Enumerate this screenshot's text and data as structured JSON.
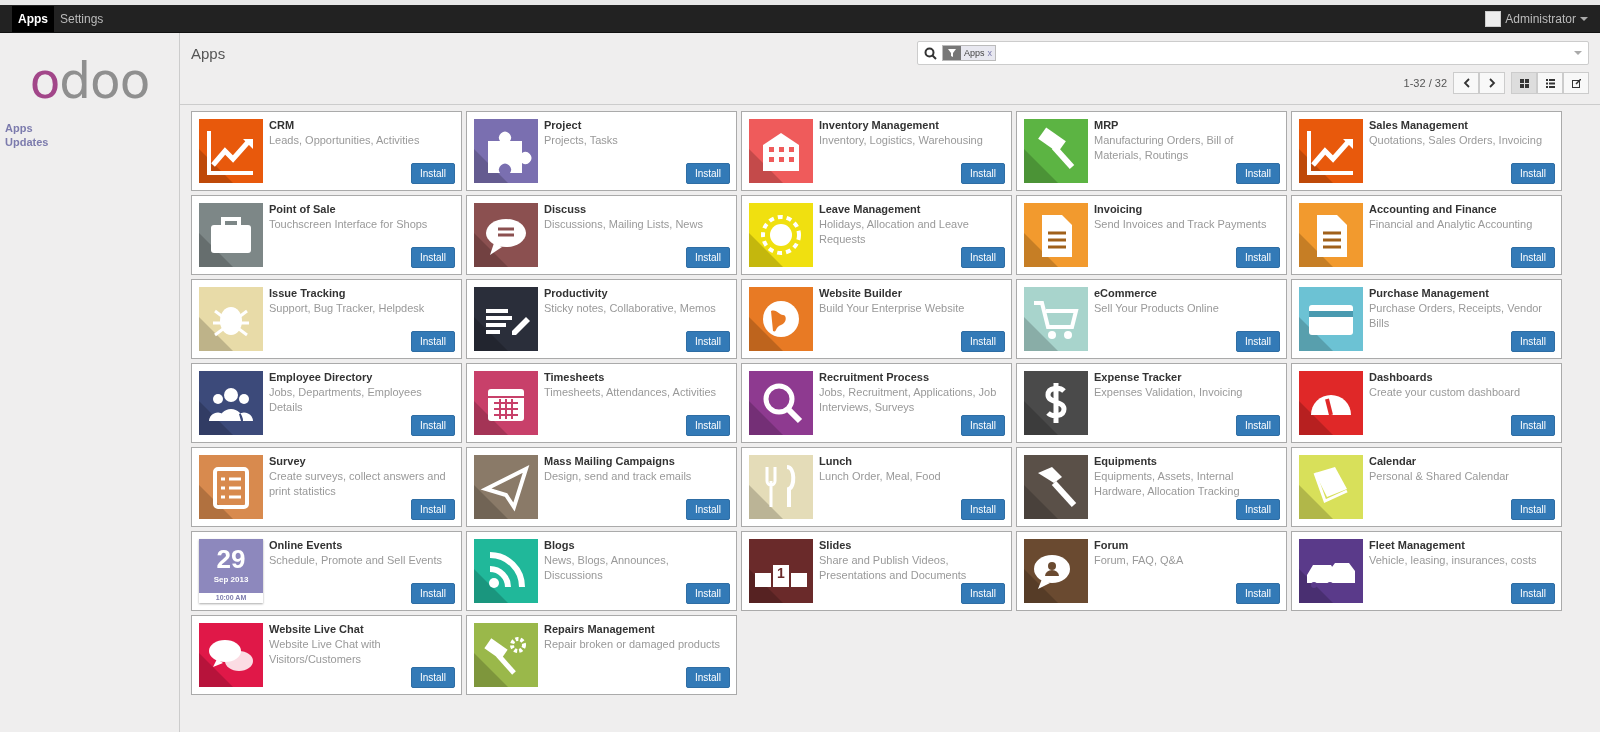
{
  "top_menu": [
    {
      "label": "Apps",
      "selected": true
    },
    {
      "label": "Settings",
      "selected": false
    }
  ],
  "user": {
    "name": "Administrator"
  },
  "logo": "odoo",
  "sidebar": {
    "items": [
      {
        "label": "Apps"
      },
      {
        "label": "Updates"
      }
    ]
  },
  "header": {
    "title": "Apps",
    "search": {
      "facet": "Apps",
      "remove": "x"
    },
    "pager": "1-32 / 32",
    "views": [
      {
        "kind": "kanban",
        "selected": true
      },
      {
        "kind": "list",
        "selected": false
      },
      {
        "kind": "form",
        "selected": false
      }
    ]
  },
  "apps": [
    {
      "name": "CRM",
      "summary": "Leads, Opportunities, Activities",
      "color": "#e8590c",
      "kind": "chart",
      "button": "Install"
    },
    {
      "name": "Project",
      "summary": "Projects, Tasks",
      "color": "#7a6fb0",
      "kind": "puzzle",
      "button": "Install"
    },
    {
      "name": "Inventory Management",
      "summary": "Inventory, Logistics, Warehousing",
      "color": "#ef5b5b",
      "kind": "building",
      "button": "Install"
    },
    {
      "name": "MRP",
      "summary": "Manufacturing Orders, Bill of Materials, Routings",
      "color": "#5cb443",
      "kind": "gavel",
      "button": "Install"
    },
    {
      "name": "Sales Management",
      "summary": "Quotations, Sales Orders, Invoicing",
      "color": "#e8590c",
      "kind": "chart",
      "button": "Install"
    },
    {
      "name": "Point of Sale",
      "summary": "Touchscreen Interface for Shops",
      "color": "#7d8787",
      "kind": "bag",
      "button": "Install"
    },
    {
      "name": "Discuss",
      "summary": "Discussions, Mailing Lists, News",
      "color": "#8b5050",
      "kind": "speech",
      "button": "Install"
    },
    {
      "name": "Leave Management",
      "summary": "Holidays, Allocation and Leave Requests",
      "color": "#f0e010",
      "kind": "sun",
      "button": "Install"
    },
    {
      "name": "Invoicing",
      "summary": "Send Invoices and Track Payments",
      "color": "#f29a2e",
      "kind": "document",
      "button": "Install"
    },
    {
      "name": "Accounting and Finance",
      "summary": "Financial and Analytic Accounting",
      "color": "#f29a2e",
      "kind": "document",
      "button": "Install"
    },
    {
      "name": "Issue Tracking",
      "summary": "Support, Bug Tracker, Helpdesk",
      "color": "#e8dba8",
      "kind": "bug",
      "button": "Install"
    },
    {
      "name": "Productivity",
      "summary": "Sticky notes, Collaborative, Memos",
      "color": "#2a2e3a",
      "kind": "notes",
      "button": "Install"
    },
    {
      "name": "Website Builder",
      "summary": "Build Your Enterprise Website",
      "color": "#e87a24",
      "kind": "globe",
      "button": "Install"
    },
    {
      "name": "eCommerce",
      "summary": "Sell Your Products Online",
      "color": "#a8d4cc",
      "kind": "cart",
      "button": "Install"
    },
    {
      "name": "Purchase Management",
      "summary": "Purchase Orders, Receipts, Vendor Bills",
      "color": "#6cc2d4",
      "kind": "card",
      "button": "Install"
    },
    {
      "name": "Employee Directory",
      "summary": "Jobs, Departments, Employees Details",
      "color": "#3c4a7a",
      "kind": "people",
      "button": "Install"
    },
    {
      "name": "Timesheets",
      "summary": "Timesheets, Attendances, Activities",
      "color": "#c8406a",
      "kind": "calendar",
      "button": "Install"
    },
    {
      "name": "Recruitment Process",
      "summary": "Jobs, Recruitment, Applications, Job Interviews, Surveys",
      "color": "#8e3a90",
      "kind": "magnifier",
      "button": "Install"
    },
    {
      "name": "Expense Tracker",
      "summary": "Expenses Validation, Invoicing",
      "color": "#4a4a4a",
      "kind": "dollar",
      "button": "Install"
    },
    {
      "name": "Dashboards",
      "summary": "Create your custom dashboard",
      "color": "#e02828",
      "kind": "gauge",
      "button": "Install"
    },
    {
      "name": "Survey",
      "summary": "Create surveys, collect answers and print statistics",
      "color": "#d88a4e",
      "kind": "clipboard",
      "button": "Install"
    },
    {
      "name": "Mass Mailing Campaigns",
      "summary": "Design, send and track emails",
      "color": "#8a7a68",
      "kind": "plane",
      "button": "Install"
    },
    {
      "name": "Lunch",
      "summary": "Lunch Order, Meal, Food",
      "color": "#e4dcb8",
      "kind": "cutlery",
      "button": "Install"
    },
    {
      "name": "Equipments",
      "summary": "Equipments, Assets, Internal Hardware, Allocation Tracking",
      "color": "#5a5048",
      "kind": "hammer",
      "button": "Install"
    },
    {
      "name": "Calendar",
      "summary": "Personal & Shared Calendar",
      "color": "#d8e05a",
      "kind": "book",
      "button": "Install"
    },
    {
      "name": "Online Events",
      "summary": "Schedule, Promote and Sell Events",
      "kind": "date",
      "day": "29",
      "month": "Sep 2013",
      "time": "10:00 AM",
      "button": "Install"
    },
    {
      "name": "Blogs",
      "summary": "News, Blogs, Announces, Discussions",
      "color": "#20b89a",
      "kind": "rss",
      "button": "Install"
    },
    {
      "name": "Slides",
      "summary": "Share and Publish Videos, Presentations and Documents",
      "color": "#6a2a2a",
      "kind": "podium",
      "rank": "1",
      "button": "Install"
    },
    {
      "name": "Forum",
      "summary": "Forum, FAQ, Q&A",
      "color": "#6a4a30",
      "kind": "chat-person",
      "button": "Install"
    },
    {
      "name": "Fleet Management",
      "summary": "Vehicle, leasing, insurances, costs",
      "color": "#5a3a8a",
      "kind": "cars",
      "button": "Install"
    },
    {
      "name": "Website Live Chat",
      "summary": "Website Live Chat with Visitors/Customers",
      "color": "#e01848",
      "kind": "chat",
      "button": "Install"
    },
    {
      "name": "Repairs Management",
      "summary": "Repair broken or damaged products",
      "color": "#9ab84a",
      "kind": "gavel-gear",
      "button": "Install"
    }
  ]
}
